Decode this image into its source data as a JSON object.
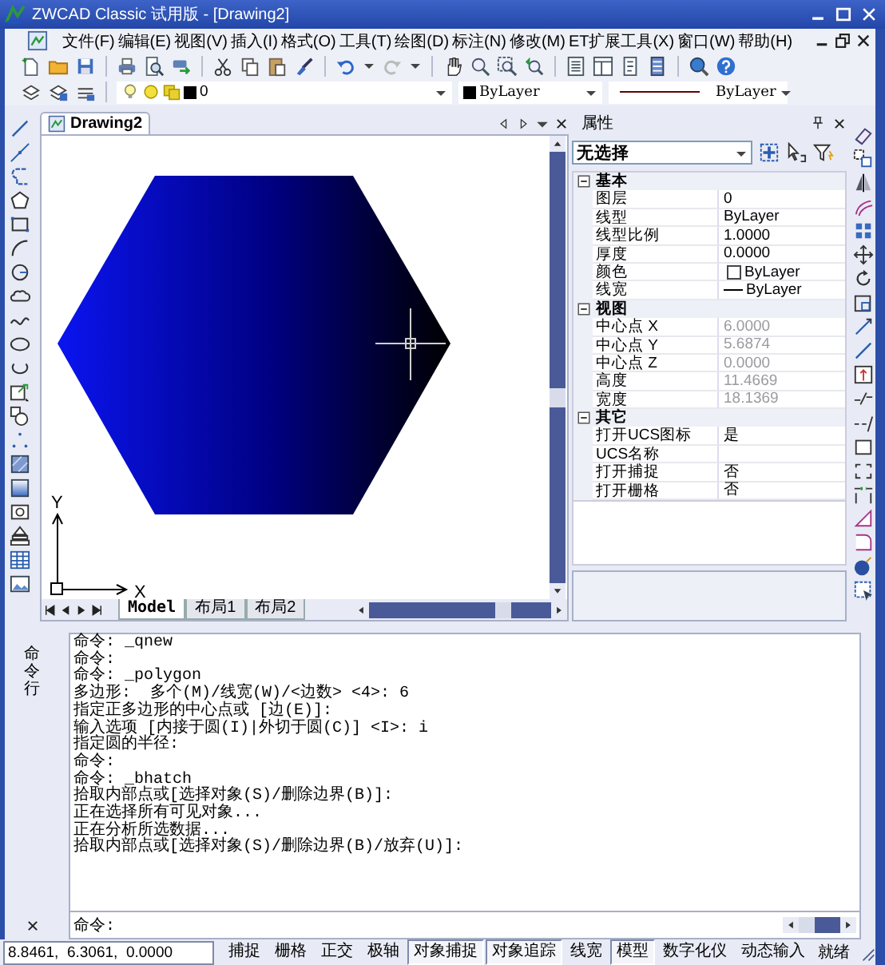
{
  "window": {
    "title": "ZWCAD Classic 试用版 - [Drawing2]"
  },
  "menu": [
    "文件(F)",
    "编辑(E)",
    "视图(V)",
    "插入(I)",
    "格式(O)",
    "工具(T)",
    "绘图(D)",
    "标注(N)",
    "修改(M)",
    "ET扩展工具(X)",
    "窗口(W)",
    "帮助(H)"
  ],
  "layer_toolbar": {
    "layer": "0",
    "color_setting": "ByLayer",
    "linetype": "ByLayer"
  },
  "document_tab": {
    "title": "Drawing2"
  },
  "canvas": {
    "axis_x": "X",
    "axis_y": "Y"
  },
  "layout_tabs": [
    {
      "label": "Model",
      "selected": true
    },
    {
      "label": "布局1",
      "selected": false
    },
    {
      "label": "布局2",
      "selected": false
    }
  ],
  "properties": {
    "title": "属性",
    "selection": "无选择",
    "sections": [
      {
        "title": "基本",
        "expanded": true,
        "rows": [
          {
            "name": "图层",
            "value": "0",
            "kind": "text",
            "disabled": false
          },
          {
            "name": "线型",
            "value": "ByLayer",
            "kind": "text",
            "disabled": false
          },
          {
            "name": "线型比例",
            "value": "1.0000",
            "kind": "text",
            "disabled": false
          },
          {
            "name": "厚度",
            "value": "0.0000",
            "kind": "text",
            "disabled": false
          },
          {
            "name": "颜色",
            "value": "ByLayer",
            "kind": "swatch",
            "disabled": false
          },
          {
            "name": "线宽",
            "value": "ByLayer",
            "kind": "line",
            "disabled": false
          }
        ]
      },
      {
        "title": "视图",
        "expanded": true,
        "rows": [
          {
            "name": "中心点 X",
            "value": "6.0000",
            "kind": "text",
            "disabled": true
          },
          {
            "name": "中心点 Y",
            "value": "5.6874",
            "kind": "text",
            "disabled": true
          },
          {
            "name": "中心点 Z",
            "value": "0.0000",
            "kind": "text",
            "disabled": true
          },
          {
            "name": "高度",
            "value": "11.4669",
            "kind": "text",
            "disabled": true
          },
          {
            "name": "宽度",
            "value": "18.1369",
            "kind": "text",
            "disabled": true
          }
        ]
      },
      {
        "title": "其它",
        "expanded": true,
        "rows": [
          {
            "name": "打开UCS图标",
            "value": "是",
            "kind": "text",
            "disabled": false
          },
          {
            "name": "UCS名称",
            "kind": "text"
          },
          {
            "name": "打开捕捉",
            "value": "否",
            "kind": "text",
            "disabled": false
          },
          {
            "name": "打开栅格",
            "value": "否",
            "kind": "text",
            "disabled": false
          }
        ]
      }
    ]
  },
  "command": {
    "title": "命令行",
    "history": [
      "命令: _qnew",
      "命令:",
      "命令: _polygon",
      "多边形:  多个(M)/线宽(W)/<边数> <4>: 6",
      "指定正多边形的中心点或 [边(E)]:",
      "输入选项 [内接于圆(I)|外切于圆(C)] <I>: i",
      "指定圆的半径:",
      "命令:",
      "命令: _bhatch",
      "拾取内部点或[选择对象(S)/删除边界(B)]:",
      "正在选择所有可见对象...",
      "正在分析所选数据...",
      "拾取内部点或[选择对象(S)/删除边界(B)/放弃(U)]:"
    ],
    "prompt": "命令:"
  },
  "status_bar": {
    "coordinates": "8.8461,  6.3061,  0.0000",
    "toggles": [
      {
        "label": "捕捉",
        "on": false
      },
      {
        "label": "栅格",
        "on": false
      },
      {
        "label": "正交",
        "on": false
      },
      {
        "label": "极轴",
        "on": false
      },
      {
        "label": "对象捕捉",
        "on": true
      },
      {
        "label": "对象追踪",
        "on": true
      },
      {
        "label": "线宽",
        "on": false
      },
      {
        "label": "模型",
        "on": true
      },
      {
        "label": "数字化仪",
        "on": false
      },
      {
        "label": "动态输入",
        "on": false
      }
    ],
    "status": "就绪"
  }
}
